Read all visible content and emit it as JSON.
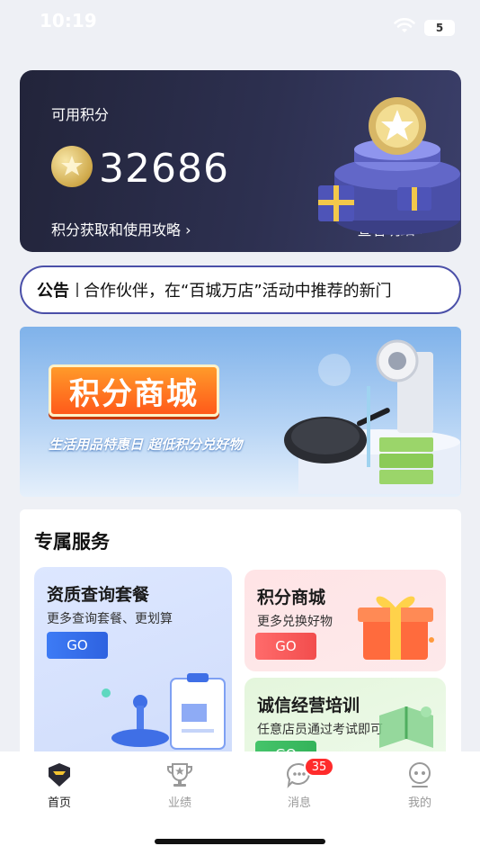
{
  "status": {
    "time": "10:19",
    "battery": "5"
  },
  "points_card": {
    "label": "可用积分",
    "value": "32686",
    "guide_link": "积分获取和使用攻略 ›",
    "detail_link": "查看明细 ›"
  },
  "notice": {
    "label": "公告",
    "text": "合作伙伴，在“百城万店”活动中推荐的新门"
  },
  "banner": {
    "title": "积分商城",
    "subtitle": "生活用品特惠日  超低积分兑好物"
  },
  "services": {
    "title": "专属服务",
    "cards": [
      {
        "name": "资质查询套餐",
        "desc": "更多查询套餐、更划算",
        "go": "GO"
      },
      {
        "name": "积分商城",
        "desc": "更多兑换好物",
        "go": "GO"
      },
      {
        "name": "诚信经营培训",
        "desc": "任意店员通过考试即可",
        "go": "GO"
      }
    ]
  },
  "tabs": [
    {
      "label": "首页",
      "icon": "home-icon"
    },
    {
      "label": "业绩",
      "icon": "trophy-icon"
    },
    {
      "label": "消息",
      "icon": "message-icon",
      "badge": "35"
    },
    {
      "label": "我的",
      "icon": "profile-icon"
    }
  ],
  "colors": {
    "accent_blue": "#2e62e0",
    "accent_red": "#f24d4d",
    "accent_green": "#34b35a",
    "badge_red": "#ff2b2b",
    "notice_border": "#4a4fa8"
  }
}
